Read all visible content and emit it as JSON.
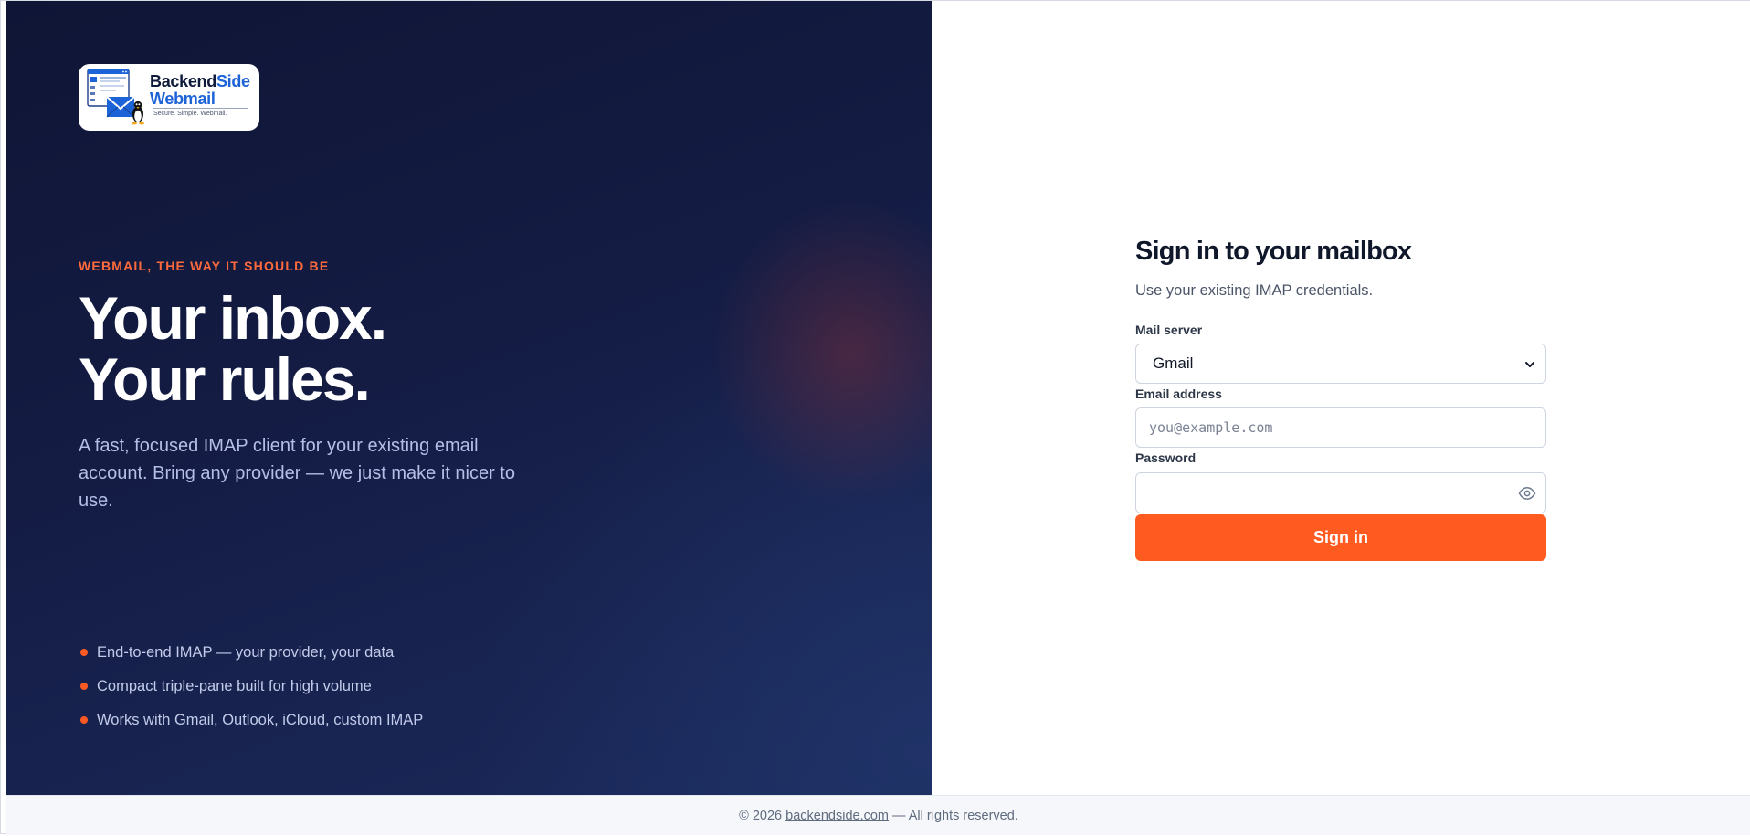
{
  "brand": {
    "name_part1": "Backend",
    "name_part2": "Side",
    "name_line2": "Webmail",
    "tagline": "Secure. Simple. Webmail.",
    "logo_icon": "mail-window-penguin-logo"
  },
  "hero": {
    "eyebrow": "WEBMAIL, THE WAY IT SHOULD BE",
    "line1": "Your inbox.",
    "line2": "Your rules.",
    "lead": "A fast, focused IMAP client for your existing email account. Bring any provider — we just make it nicer to use."
  },
  "features": [
    "End-to-end IMAP — your provider, your data",
    "Compact triple-pane built for high volume",
    "Works with Gmail, Outlook, iCloud, custom IMAP"
  ],
  "form": {
    "title": "Sign in to your mailbox",
    "subtitle": "Use your existing IMAP credentials.",
    "server_label": "Mail server",
    "server_value": "Gmail",
    "email_label": "Email address",
    "email_placeholder": "you@example.com",
    "password_label": "Password",
    "password_value": "",
    "submit_label": "Sign in"
  },
  "footer": {
    "prefix": "© 2026 ",
    "link": "backendside.com",
    "suffix": " — All rights reserved."
  },
  "colors": {
    "accent": "#ff5a1f",
    "brand_blue": "#1d63d8",
    "panel_dark": "#131a40"
  }
}
